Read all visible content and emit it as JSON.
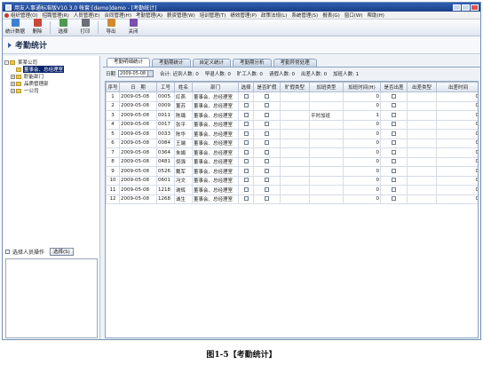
{
  "window": {
    "title": "用友人事通标准版V10.3.0  帐套:[demo]demo - [考勤统计]"
  },
  "menu": [
    "组织管理(O)",
    "招聘管理(R)",
    "人员管理(E)",
    "合同管理(H)",
    "考勤管理(A)",
    "薪资管理(W)",
    "培训管理(T)",
    "绩效管理(P)",
    "政策法规(L)",
    "系统管理(S)",
    "报表(G)",
    "窗口(W)",
    "帮助(H)"
  ],
  "toolbar": [
    {
      "label": "统计数据",
      "icon": "statistics-icon",
      "color": "#3f7fd0"
    },
    {
      "label": "删除",
      "icon": "delete-icon",
      "color": "#c94a3a"
    },
    {
      "label": "选择",
      "icon": "select-icon",
      "color": "#4f9a4f"
    },
    {
      "label": "打印",
      "icon": "print-icon",
      "color": "#6a6f7a"
    },
    {
      "label": "导出",
      "icon": "export-icon",
      "color": "#d08a2f"
    },
    {
      "label": "关闭",
      "icon": "close-icon",
      "color": "#7a4fb0"
    }
  ],
  "page": {
    "title": "考勤统计"
  },
  "tree": [
    {
      "label": "某某公司",
      "level": 0,
      "expander": "-"
    },
    {
      "label": "董事会、总经理室",
      "level": 1,
      "expander": "",
      "selected": true
    },
    {
      "label": "职能部门",
      "level": 1,
      "expander": "+"
    },
    {
      "label": "品质管理部",
      "level": 1,
      "expander": "+"
    },
    {
      "label": "一公司",
      "level": 1,
      "expander": "+"
    }
  ],
  "left": {
    "select_person_label": "选择人员操作",
    "select_button": "选择(S)"
  },
  "tabs": [
    "考勤明细统计",
    "考勤期统计",
    "自定义统计",
    "考勤期分析",
    "考勤异常处理"
  ],
  "filter": {
    "date_label": "日期",
    "date_value": "2009-05-08",
    "total": "合计: 迟到人数: 0",
    "early": "早退人数: 0",
    "absent": "旷工人数: 0",
    "leave": "请假人数: 0",
    "trip": "出差人数: 0",
    "overtime": "加班人数: 1"
  },
  "table": {
    "headers": [
      "序号",
      "日　期",
      "工号",
      "姓名",
      "部门",
      "选择",
      "是否旷假",
      "旷假类型",
      "加班类型",
      "加班时间(H)",
      "是否出差",
      "出差类型",
      "出差时间"
    ],
    "rows": [
      [
        "1",
        "2009-05-08",
        "0005",
        "红燕",
        "董事会、总经理室",
        "",
        "",
        "",
        "",
        "0",
        "",
        "",
        "0"
      ],
      [
        "2",
        "2009-05-08",
        "0009",
        "董苏",
        "董事会、总经理室",
        "",
        "",
        "",
        "",
        "0",
        "",
        "",
        "0"
      ],
      [
        "3",
        "2009-05-08",
        "0011",
        "陈璐",
        "董事会、总经理室",
        "",
        "",
        "",
        "平时加班",
        "1",
        "",
        "",
        "0"
      ],
      [
        "4",
        "2009-05-08",
        "0017",
        "张平",
        "董事会、总经理室",
        "",
        "",
        "",
        "",
        "0",
        "",
        "",
        "0"
      ],
      [
        "5",
        "2009-05-08",
        "0033",
        "陈华",
        "董事会、总经理室",
        "",
        "",
        "",
        "",
        "0",
        "",
        "",
        "0"
      ],
      [
        "6",
        "2009-05-08",
        "0084",
        "王端",
        "董事会、总经理室",
        "",
        "",
        "",
        "",
        "0",
        "",
        "",
        "0"
      ],
      [
        "7",
        "2009-05-08",
        "0364",
        "朱娟",
        "董事会、总经理室",
        "",
        "",
        "",
        "",
        "0",
        "",
        "",
        "0"
      ],
      [
        "8",
        "2009-05-08",
        "0481",
        "倪强",
        "董事会、总经理室",
        "",
        "",
        "",
        "",
        "0",
        "",
        "",
        "0"
      ],
      [
        "9",
        "2009-05-08",
        "0526",
        "戴军",
        "董事会、总经理室",
        "",
        "",
        "",
        "",
        "0",
        "",
        "",
        "0"
      ],
      [
        "10",
        "2009-05-08",
        "0601",
        "冯文",
        "董事会、总经理室",
        "",
        "",
        "",
        "",
        "0",
        "",
        "",
        "0"
      ],
      [
        "11",
        "2009-05-08",
        "1218",
        "谢辉",
        "董事会、总经理室",
        "",
        "",
        "",
        "",
        "0",
        "",
        "",
        "0"
      ],
      [
        "12",
        "2009-05-08",
        "1268",
        "诚生",
        "董事会、总经理室",
        "",
        "",
        "",
        "",
        "0",
        "",
        "",
        "0"
      ]
    ]
  },
  "caption": "图1-5【考勤统计】"
}
